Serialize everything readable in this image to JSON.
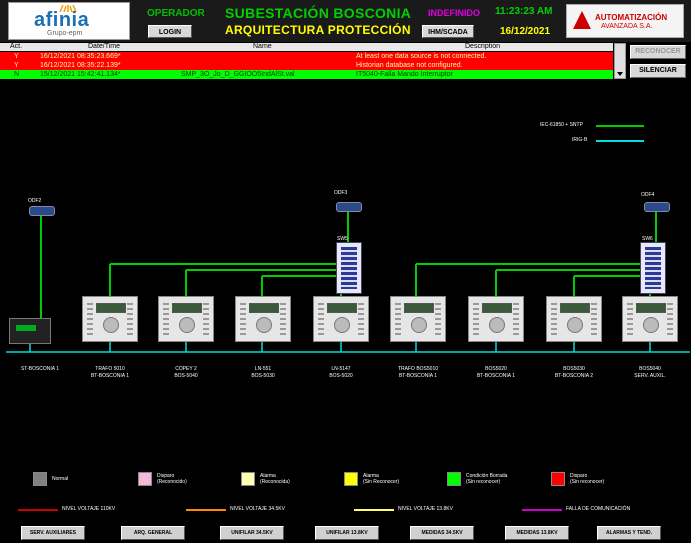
{
  "header": {
    "logo_main": "afinia",
    "logo_sub": "Grupo-epm",
    "operator_label": "OPERADOR",
    "login_button": "LOGIN",
    "title": "SUBESTACIÓN BOSCONIA",
    "subtitle": "ARQUITECTURA PROTECCIÓN",
    "status": "INDEFINIDO",
    "time": "11:23:23 AM",
    "date": "16/12/2021",
    "hmi_button": "IHM/SCADA",
    "brand_line1": "AUTOMATIZACIÓN",
    "brand_line2": "AVANZADA S.A."
  },
  "alarms": {
    "columns": [
      "Act.",
      "Date/Time",
      "Name",
      "Description"
    ],
    "rows": [
      {
        "act": "Y",
        "datetime": "16/12/2021 08:35:23.669*",
        "name": "",
        "description": "At least one data source is not connected.",
        "color": "#ff0000"
      },
      {
        "act": "Y",
        "datetime": "16/12/2021 08:35:22.139*",
        "name": "",
        "description": "Historian database not configured.",
        "color": "#ff0000"
      },
      {
        "act": "N",
        "datetime": "15/12/2021 15:42:41.134*",
        "name": "SMP_3O_Jo_D_GGIOO5IndAlSt.val",
        "description": "IT5040-Falla Mando Interruptor",
        "color": "#00ff00"
      }
    ],
    "buttons": {
      "ack": "RECONOCER",
      "silence": "SILENCIAR"
    }
  },
  "network_legend": [
    {
      "label": "IEC-61850 + SNTP",
      "color": "#00cc00"
    },
    {
      "label": "IRIG-B",
      "color": "#00dddd"
    }
  ],
  "routers": [
    "ODF2",
    "ODF3",
    "ODF4"
  ],
  "switches": [
    "SW5",
    "SW6"
  ],
  "devices": [
    {
      "line1": "ST-BOSCONIA 1",
      "line2": ""
    },
    {
      "line1": "TRAFO 5010",
      "line2": "BT-BOSCONIA 1"
    },
    {
      "line1": "COPEY 2",
      "line2": "BOS-5040"
    },
    {
      "line1": "LN-551",
      "line2": "BOS-5030"
    },
    {
      "line1": "LN-5147",
      "line2": "BOS-5020"
    },
    {
      "line1": "TRAFO BOS5010",
      "line2": "BT-BOSCONIA 1"
    },
    {
      "line1": "BOS5020",
      "line2": "BT-BOSCONIA 1"
    },
    {
      "line1": "BOS5030",
      "line2": "BT-BOSCONIA 2"
    },
    {
      "line1": "BOS5040",
      "line2": "SERV. AUXIL."
    }
  ],
  "status_legend": [
    {
      "label": "Normal",
      "sub": "",
      "color": "#808080"
    },
    {
      "label": "Disparo",
      "sub": "(Reconocido)",
      "color": "#f4b8d8"
    },
    {
      "label": "Alarma",
      "sub": "(Reconocida)",
      "color": "#ffffb0"
    },
    {
      "label": "Alarma",
      "sub": "(Sin Reconocer)",
      "color": "#ffff00"
    },
    {
      "label": "Condición Borrada",
      "sub": "(Sin reconocer)",
      "color": "#00ff00"
    },
    {
      "label": "Disparo",
      "sub": "(Sin reconocer)",
      "color": "#ff0000"
    }
  ],
  "voltage_legend": [
    {
      "label": "NIVEL VOLTAJE 110KV",
      "color": "#cc0000"
    },
    {
      "label": "NIVEL VOLTAJE 34.5KV",
      "color": "#ff8800"
    },
    {
      "label": "NIVEL VOLTAJE 13.8KV",
      "color": "#ffff66"
    },
    {
      "label": "FALLA DE COMUNICACIÓN",
      "color": "#cc00cc"
    }
  ],
  "nav": [
    "SERV. AUXILIARES",
    "ARQ. GENERAL",
    "UNIFILAR 34.5KV",
    "UNIFILAR 13.8KV",
    "MEDIDAS 34.5KV",
    "MEDIDAS 13.8KV",
    "ALARMAS Y TEND."
  ]
}
